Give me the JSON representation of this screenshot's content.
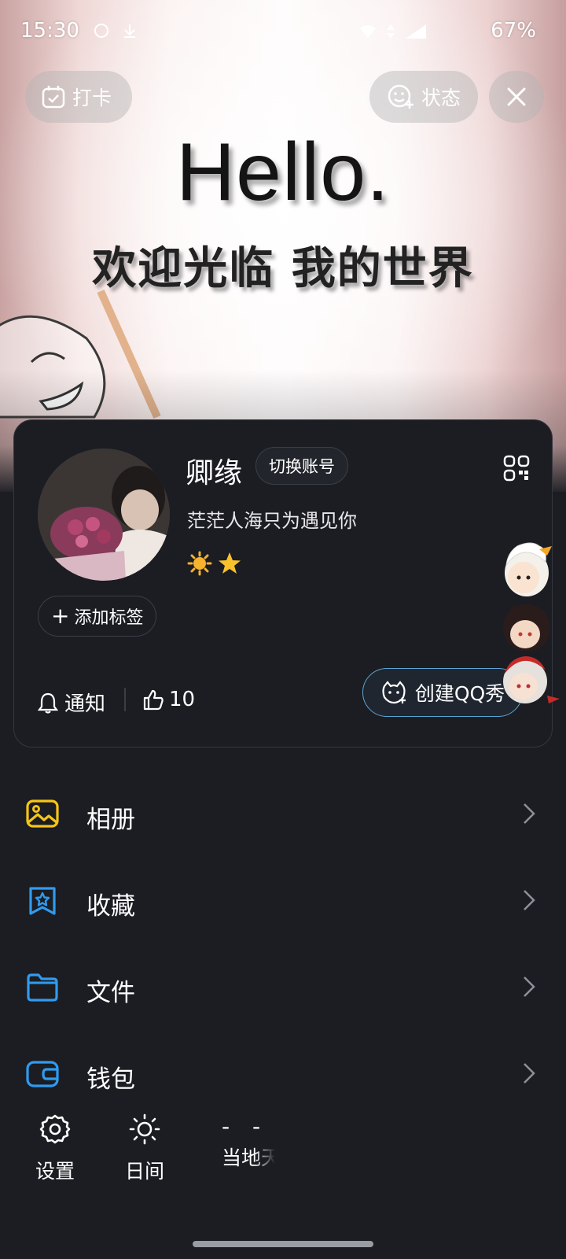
{
  "status_bar": {
    "time": "15:30",
    "battery": "67%"
  },
  "banner": {
    "headline": "Hello.",
    "subline": "欢迎光临 我的世界"
  },
  "top_actions": {
    "checkin_label": "打卡",
    "status_label": "状态"
  },
  "profile": {
    "nickname": "卿缘",
    "switch_account_label": "切换账号",
    "signature": "茫茫人海只为遇见你",
    "add_tag_label": "添加标签",
    "notify_label": "通知",
    "like_count": "10",
    "create_qqshow_label": "创建QQ秀"
  },
  "menu": {
    "items": [
      {
        "label": "相册",
        "icon": "album-icon"
      },
      {
        "label": "收藏",
        "icon": "favorites-icon"
      },
      {
        "label": "文件",
        "icon": "folder-icon"
      },
      {
        "label": "钱包",
        "icon": "wallet-icon"
      }
    ]
  },
  "bottom_bar": {
    "settings_label": "设置",
    "day_mode_label": "日间",
    "weather_value": "- -",
    "weather_label": "当地天"
  },
  "colors": {
    "background": "#1b1d22",
    "album_icon": "#f5c518",
    "accent_blue": "#2f9bf0",
    "qqshow_border": "#5aa6d6"
  }
}
